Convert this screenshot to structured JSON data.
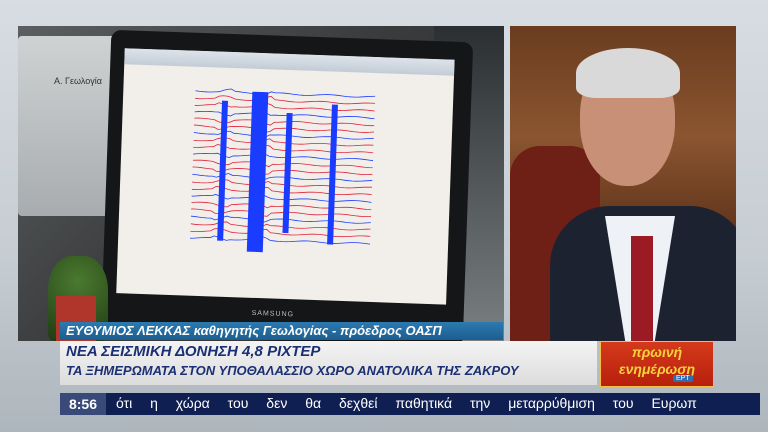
{
  "lower_third": {
    "name_caption": "ΕΥΘΥΜΙΟΣ ΛΕΚΚΑΣ καθηγητής Γεωλογίας - πρόεδρος ΟΑΣΠ"
  },
  "headline": {
    "line1": "ΝΕΑ ΣΕΙΣΜΙΚΗ ΔΟΝΗΣΗ 4,8 ΡΙΧΤΕΡ",
    "line2": "ΤΑ ΞΗΜΕΡΩΜΑΤΑ  ΣΤΟΝ ΥΠΟΘΑΛΑΣΣΙΟ ΧΩΡΟ ΑΝΑΤΟΛΙΚΑ ΤΗΣ ΖΑΚΡΟΥ"
  },
  "logo": {
    "line1": "πρωινή",
    "line2": "ενημέρωση",
    "badge": "ΕΡΤ"
  },
  "ticker": {
    "time": "8:56",
    "text": "ότι η χώρα του δεν θα δεχθεί παθητικά την μεταρρύθμιση του Ευρωπ"
  },
  "monitor": {
    "brand": "SAMSUNG",
    "printer_label": "Α. Γεωλογία"
  },
  "colors": {
    "name_strip": "#1d5d8f",
    "headline_text": "#1a2f74",
    "logo_bg": "#c22a12",
    "logo_text": "#f7d23a",
    "ticker_bg": "#101f52",
    "seismogram_red": "#e0203a",
    "seismogram_blue": "#1a3cff"
  }
}
